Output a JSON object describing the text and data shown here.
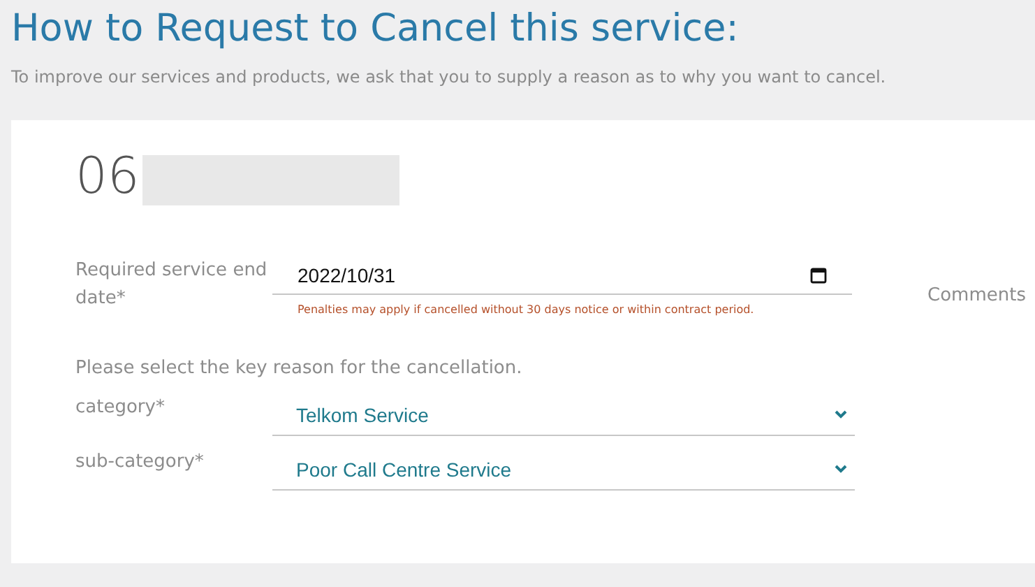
{
  "heading": "How to Request to Cancel this service:",
  "intro": "To improve our services and products, we ask that you to supply a reason as to why you want to cancel.",
  "service_number": "06",
  "end_date": {
    "label": "Required service end date*",
    "value": "2022/10/31",
    "note": "Penalties may apply if cancelled without 30 days notice or within contract period."
  },
  "comments_label": "Comments",
  "reason_prompt": "Please select the key reason for the cancellation.",
  "selects": [
    {
      "label": "category*",
      "value": "Telkom Service"
    },
    {
      "label": "sub-category*",
      "value": "Poor Call Centre Service"
    }
  ]
}
